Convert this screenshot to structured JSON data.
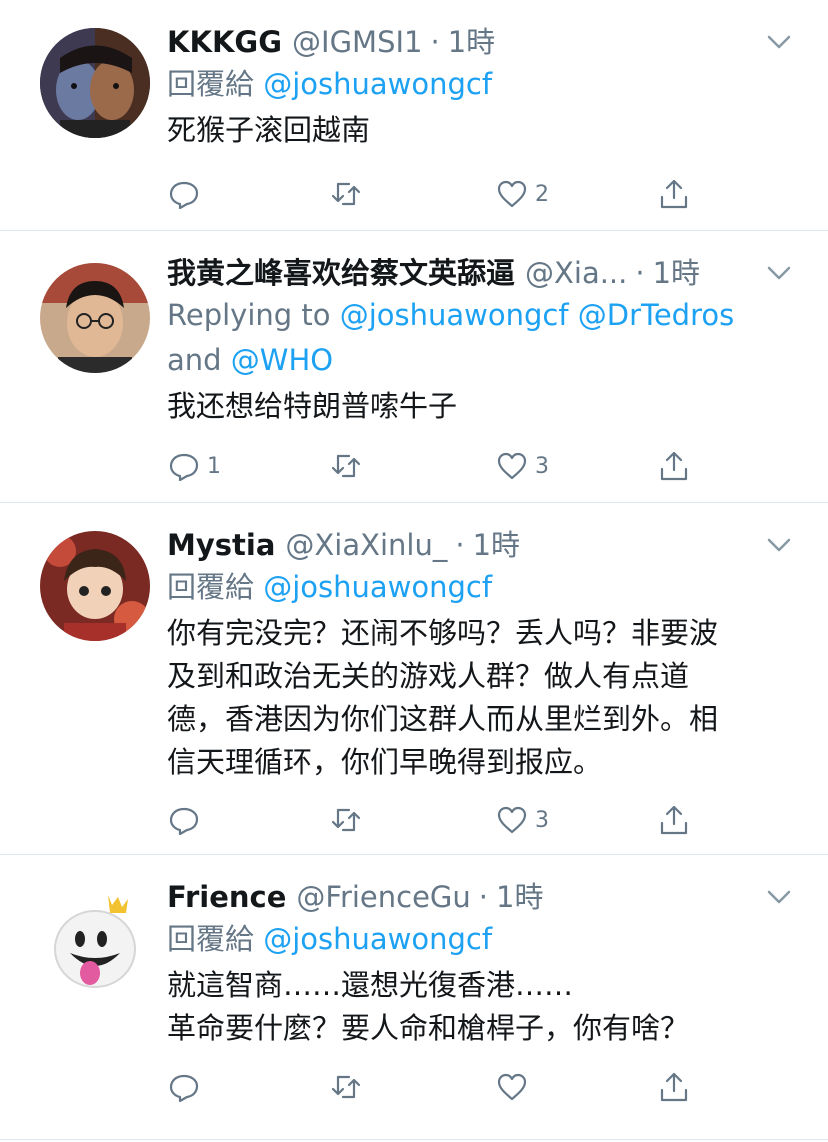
{
  "tweets": [
    {
      "name": "KKKGG",
      "handle": "@IGMSI1",
      "time": "1時",
      "reply_prefix": "回覆給 ",
      "reply_targets": "@joshuawongcf",
      "reply_and": "",
      "reply_targets2": "",
      "text": "死猴子滚回越南",
      "reply_count": "",
      "like_count": "2"
    },
    {
      "name": "我黄之峰喜欢给蔡文英舔逼",
      "handle": "@Xia...",
      "time": "1時",
      "reply_prefix": "Replying to ",
      "reply_targets": "@joshuawongcf @DrTedros",
      "reply_and": "and ",
      "reply_targets2": "@WHO",
      "text": "我还想给特朗普嗦牛子",
      "reply_count": "1",
      "like_count": "3"
    },
    {
      "name": "Mystia",
      "handle": "@XiaXinlu_",
      "time": "1時",
      "reply_prefix": "回覆給 ",
      "reply_targets": "@joshuawongcf",
      "reply_and": "",
      "reply_targets2": "",
      "text": "你有完没完？还闹不够吗？丢人吗？非要波\n及到和政治无关的游戏人群？做人有点道\n德，香港因为你们这群人而从里烂到外。相\n信天理循环，你们早晚得到报应。",
      "reply_count": "",
      "like_count": "3"
    },
    {
      "name": "Frience",
      "handle": "@FrienceGu",
      "time": "1時",
      "reply_prefix": "回覆給 ",
      "reply_targets": "@joshuawongcf",
      "reply_and": "",
      "reply_targets2": "",
      "text": "就這智商……還想光復香港……\n革命要什麼？要人命和槍桿子，你有啥？",
      "reply_count": "",
      "like_count": ""
    }
  ],
  "separator": "·",
  "icons": [
    "avatar",
    "chevron-down-icon",
    "reply-icon",
    "retweet-icon",
    "like-icon",
    "share-icon"
  ],
  "colors": {
    "link": "#1da1f2",
    "secondary": "#657786",
    "text": "#14171a",
    "divider": "#e1e8ed"
  }
}
